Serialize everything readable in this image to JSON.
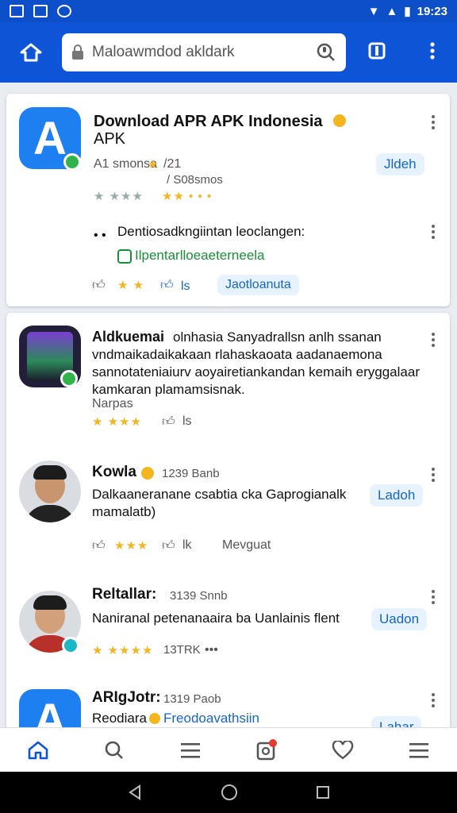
{
  "status": {
    "time": "19:23"
  },
  "search": {
    "text": "Maloawmdod akldark"
  },
  "card1": {
    "title": "Download APR APK Indonesia",
    "title2": "APK",
    "meta1": "A1 smonsa",
    "meta1b": "/21",
    "meta2": "/ S08smos",
    "install_pill": "Jldeh",
    "section_text": "Dentiosadkngiintan leoclangen:",
    "green_link": "Ilpentarlloeaeterneela",
    "action_count": "ls",
    "action_link": "Jaotloanuta"
  },
  "card2": {
    "post1": {
      "name": "Aldkuemai",
      "lines": [
        "olnhasia Sanyadrallsn anlh ssanan",
        "vndmaikadaikakaan rlahaskaoata aadanaemona",
        "sannotateniaiurv aoyairetiankandan kemaih eryggalaar",
        "kamkaran plamamsisnak."
      ],
      "sub": "Narpas",
      "thumb_count": "ls"
    },
    "post2": {
      "name": "Kowla",
      "time": "1239 Banb",
      "text1": "Dalkaaneranane csabtia cka Gaprogianalk",
      "text2": "mamalatb)",
      "pill": "Ladoh",
      "thumb_count": "lk",
      "extra": "Mevguat"
    },
    "post3": {
      "name": "Reltallar:",
      "time": "3139 Snnb",
      "text": "Naniranal  petenanaaira ba Uanlainis flent",
      "pill": "Uadon",
      "count": "13TRK"
    },
    "post4": {
      "name": "ARIgJotr:",
      "time": "1319 Paob",
      "text": "Reodiara",
      "link": "Freodoavathsiin",
      "pill": "Lahar"
    }
  },
  "colors": {
    "primary": "#0d55d6",
    "accent_blue": "#1666c9",
    "star": "#f3b61f",
    "green": "#2fb34a"
  },
  "bottom_nav": [
    "home-icon",
    "search-icon",
    "menu-icon",
    "notifications-icon",
    "heart-icon",
    "more-menu-icon"
  ]
}
